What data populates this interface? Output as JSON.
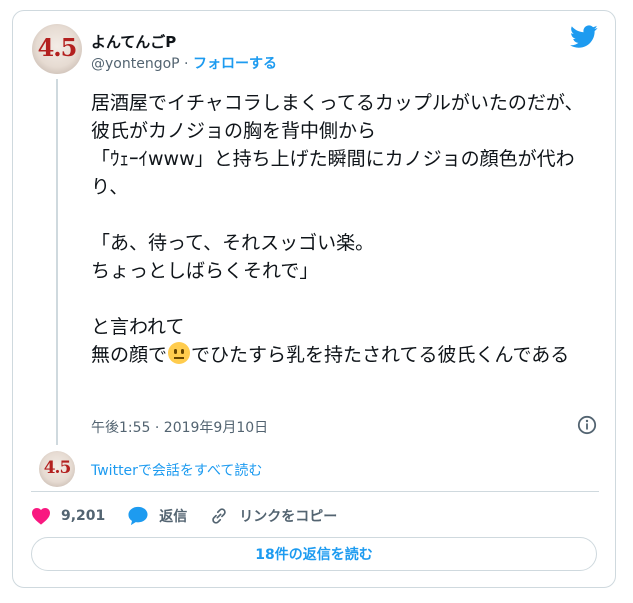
{
  "author": {
    "display_name": "よんてんごP",
    "handle": "@yontengoP",
    "separator": "·",
    "follow_label": "フォローする",
    "avatar_text": "4.5"
  },
  "tweet": {
    "text_before_emoji": "居酒屋でイチャコラしまくってるカップルがいたのだが、\n彼氏がカノジョの胸を背中側から\n「ｳｪｰｲwww」と持ち上げた瞬間にカノジョの顔色が代わり、\n\n「あ、待って、それスッゴい楽。\nちょっとしばらくそれで」\n\nと言われて\n無の顔で",
    "text_after_emoji": "でひたすら乳を持たされてる彼氏くんである",
    "emoji_icon": "neutral-face-emoji",
    "timestamp": "午後1:55 · 2019年9月10日"
  },
  "conversation": {
    "link_label": "Twitterで会話をすべて読む"
  },
  "actions": {
    "like_count": "9,201",
    "reply_label": "返信",
    "copy_link_label": "リンクをコピー"
  },
  "footer": {
    "read_replies_label": "18件の返信を読む"
  },
  "colors": {
    "accent": "#1d9bf0",
    "like": "#f91880",
    "text": "#0f1419",
    "muted": "#536471",
    "border": "#cfd9de"
  }
}
